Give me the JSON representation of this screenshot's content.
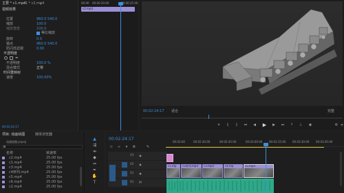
{
  "effect_controls": {
    "tab_label": "主要 * c1.mp4",
    "clip_label": "c1 * c2.mp4",
    "mini_ruler": [
      "00:00",
      "00:00:20:00",
      "00:00:25:00"
    ],
    "mini_clip_name": "c2.mp4",
    "section_video": "视频效果",
    "props": [
      {
        "label": "位置",
        "v1": "960.0",
        "v2": "540.0"
      },
      {
        "label": "缩放",
        "v1": "100.0",
        "v2": ""
      },
      {
        "label": "缩放宽度",
        "v1": "100.0",
        "v2": ""
      },
      {
        "label": "等比缩放",
        "v1": "",
        "v2": ""
      },
      {
        "label": "旋转",
        "v1": "0.0",
        "v2": ""
      },
      {
        "label": "锚点",
        "v1": "960.0",
        "v2": "540.0"
      },
      {
        "label": "防闪烁滤镜",
        "v1": "0.00",
        "v2": ""
      }
    ],
    "section_opacity": "不透明度",
    "opacity_value": "100.0 %",
    "blend_label": "混合模式",
    "blend_value": "正常",
    "section_time": "时间重映射",
    "speed_label": "速度",
    "speed_value": "100.00%",
    "timecode": "00:02:24:17"
  },
  "program_monitor": {
    "timecode": "00:02:24:17",
    "fit_label": "适合",
    "full_label": "完整"
  },
  "project_panel": {
    "tab_project": "项目: 动画绘图",
    "tab_media": "媒体浏览器",
    "search_path": "动画绘图.prproj",
    "columns": {
      "name": "名称",
      "rate": "帧速率"
    },
    "items": [
      {
        "name": "c2.mp4",
        "rate": "25.00 fps"
      },
      {
        "name": "c1.mp4",
        "rate": "25.00 fps"
      },
      {
        "name": "c3.mp4",
        "rate": "25.00 fps"
      },
      {
        "name": "c4序列.mp4",
        "rate": "25.00 fps"
      },
      {
        "name": "c5.mp4",
        "rate": "25.00 fps"
      },
      {
        "name": "c6.mp4",
        "rate": "25.00 fps"
      },
      {
        "name": "c2.mp4",
        "rate": "25.00 fps"
      }
    ]
  },
  "timeline": {
    "timecode": "00:02:24:17",
    "ruler": [
      "00:02:00",
      "00:02:30:00",
      "00:02:45:00",
      "00:03:00:00",
      "00:03:15:00",
      "00:03:30:00",
      "00:03:45:00"
    ],
    "tracks": [
      "V3",
      "V2",
      "V1",
      "A1",
      "A2"
    ],
    "clip_labels": [
      "c1.mp",
      "c2序列.mp4",
      "c3.mp4",
      "c4.mp",
      "c5.mp4"
    ]
  },
  "colors": {
    "accent": "#3d8fe0",
    "clip_video": "#9b8fd4",
    "clip_audio": "#2ea98a",
    "clip_pink": "#d58ad0"
  }
}
